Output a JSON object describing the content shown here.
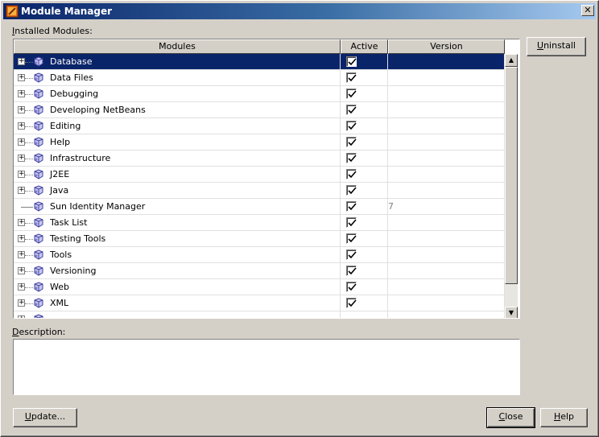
{
  "window": {
    "title": "Module Manager",
    "close_glyph": "✕"
  },
  "installed_label": "Installed Modules:",
  "table": {
    "headers": {
      "modules": "Modules",
      "active": "Active",
      "version": "Version"
    },
    "rows": [
      {
        "name": "Database",
        "expandable": true,
        "active": true,
        "version": "",
        "selected": true
      },
      {
        "name": "Data Files",
        "expandable": true,
        "active": true,
        "version": ""
      },
      {
        "name": "Debugging",
        "expandable": true,
        "active": true,
        "version": ""
      },
      {
        "name": "Developing NetBeans",
        "expandable": true,
        "active": true,
        "version": ""
      },
      {
        "name": "Editing",
        "expandable": true,
        "active": true,
        "version": ""
      },
      {
        "name": "Help",
        "expandable": true,
        "active": true,
        "version": ""
      },
      {
        "name": "Infrastructure",
        "expandable": true,
        "active": true,
        "version": ""
      },
      {
        "name": "J2EE",
        "expandable": true,
        "active": true,
        "version": ""
      },
      {
        "name": "Java",
        "expandable": true,
        "active": true,
        "version": ""
      },
      {
        "name": "Sun Identity Manager",
        "expandable": false,
        "active": true,
        "version": "7"
      },
      {
        "name": "Task List",
        "expandable": true,
        "active": true,
        "version": ""
      },
      {
        "name": "Testing Tools",
        "expandable": true,
        "active": true,
        "version": ""
      },
      {
        "name": "Tools",
        "expandable": true,
        "active": true,
        "version": ""
      },
      {
        "name": "Versioning",
        "expandable": true,
        "active": true,
        "version": ""
      },
      {
        "name": "Web",
        "expandable": true,
        "active": true,
        "version": ""
      },
      {
        "name": "XML",
        "expandable": true,
        "active": true,
        "version": ""
      },
      {
        "name": "",
        "expandable": true,
        "active": false,
        "version": ""
      }
    ]
  },
  "description_label": "Description:",
  "description_text": "",
  "buttons": {
    "uninstall": "Uninstall",
    "update": "Update...",
    "close": "Close",
    "help": "Help"
  },
  "scrollbar": {
    "up": "▲",
    "down": "▼"
  },
  "colors": {
    "selection": "#0a246a",
    "title_start": "#0a246a",
    "title_end": "#a6caf0"
  }
}
